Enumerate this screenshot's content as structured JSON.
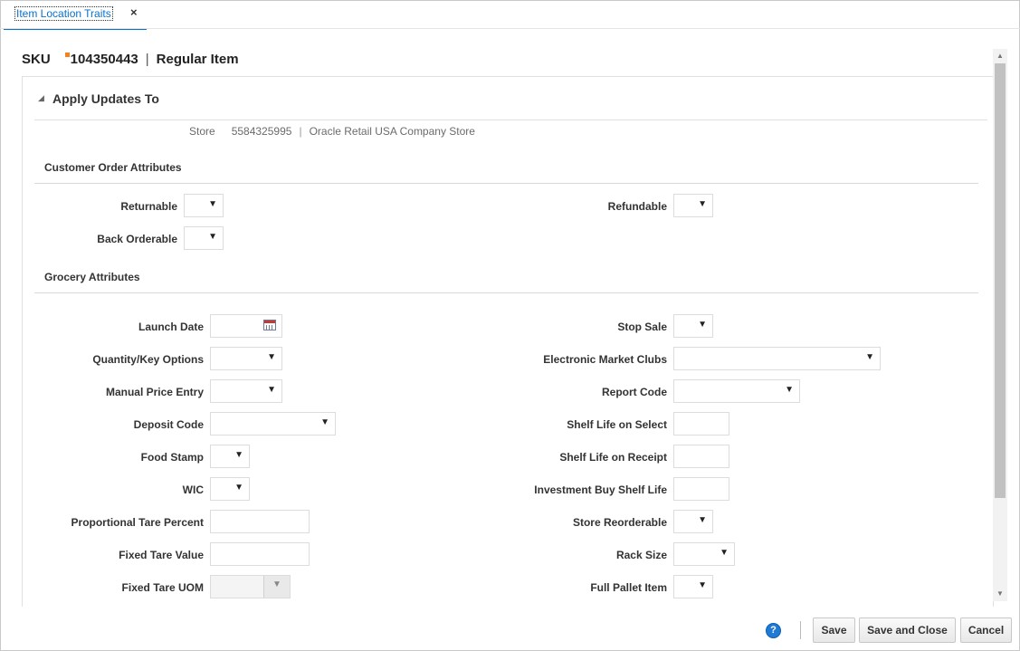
{
  "tab": {
    "label": "Item Location Traits",
    "close": "×"
  },
  "header": {
    "sku_label": "SKU",
    "sku_value": "104350443",
    "separator": "|",
    "item_type": "Regular Item"
  },
  "section": {
    "toggle": "◢",
    "title": "Apply Updates To"
  },
  "store": {
    "label": "Store",
    "id": "5584325995",
    "separator": "|",
    "name": "Oracle Retail USA Company Store"
  },
  "groups": {
    "customer": "Customer Order Attributes",
    "grocery": "Grocery Attributes"
  },
  "fields": {
    "returnable": "Returnable",
    "refundable": "Refundable",
    "back_orderable": "Back Orderable",
    "launch_date": "Launch Date",
    "quantity_key_options": "Quantity/Key Options",
    "manual_price_entry": "Manual Price Entry",
    "deposit_code": "Deposit Code",
    "food_stamp": "Food Stamp",
    "wic": "WIC",
    "proportional_tare_percent": "Proportional Tare Percent",
    "fixed_tare_value": "Fixed Tare Value",
    "fixed_tare_uom": "Fixed Tare UOM",
    "stop_sale": "Stop Sale",
    "electronic_market_clubs": "Electronic Market Clubs",
    "report_code": "Report Code",
    "shelf_life_on_select": "Shelf Life on Select",
    "shelf_life_on_receipt": "Shelf Life on Receipt",
    "investment_buy_shelf_life": "Investment Buy Shelf Life",
    "store_reorderable": "Store Reorderable",
    "rack_size": "Rack Size",
    "full_pallet_item": "Full Pallet Item"
  },
  "icons": {
    "dropdown": "▼",
    "calendar": "calendar-icon",
    "help": "?"
  },
  "footer": {
    "help": "?",
    "save": "Save",
    "save_and_close": "Save and Close",
    "cancel": "Cancel"
  },
  "colors": {
    "accent": "#0572ce",
    "required": "#f5821f",
    "help": "#1f7ad6"
  }
}
